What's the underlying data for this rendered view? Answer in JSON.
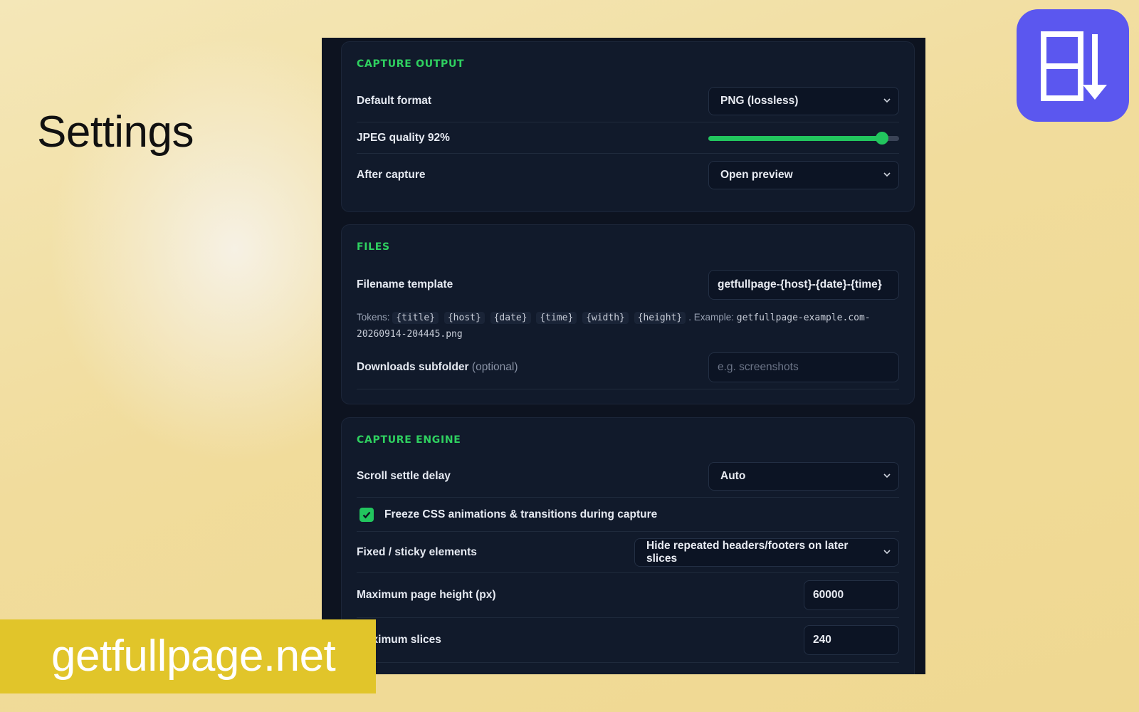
{
  "promo": {
    "title": "Settings",
    "banner": "getfullpage.net",
    "logo_icon": "page-download-icon",
    "logo_color": "#5b57ef",
    "banner_color": "#e1c52a"
  },
  "theme": {
    "accent": "#22c55e",
    "section_title_color": "#2fd160",
    "panel_bg": "#0d1320"
  },
  "capture_output": {
    "title": "CAPTURE OUTPUT",
    "default_format_label": "Default format",
    "default_format_value": "PNG (lossless)",
    "jpeg_quality_label": "JPEG quality 92%",
    "jpeg_quality_value": 92,
    "after_capture_label": "After capture",
    "after_capture_value": "Open preview"
  },
  "files": {
    "title": "FILES",
    "filename_template_label": "Filename template",
    "filename_template_value": "getfullpage-{host}-{date}-{time}",
    "tokens_prefix": "Tokens:",
    "tokens": [
      "{title}",
      "{host}",
      "{date}",
      "{time}",
      "{width}",
      "{height}"
    ],
    "example_prefix": ". Example:",
    "example_value": "getfullpage-example.com-20260914-204445.png",
    "subfolder_label": "Downloads subfolder",
    "subfolder_optional": "(optional)",
    "subfolder_placeholder": "e.g. screenshots"
  },
  "capture_engine": {
    "title": "CAPTURE ENGINE",
    "scroll_settle_label": "Scroll settle delay",
    "scroll_settle_value": "Auto",
    "freeze_label": "Freeze CSS animations & transitions during capture",
    "freeze_checked": true,
    "fixed_sticky_label": "Fixed / sticky elements",
    "fixed_sticky_value": "Hide repeated headers/footers on later slices",
    "max_height_label": "Maximum page height (px)",
    "max_height_value": "60000",
    "max_slices_label": "Maximum slices",
    "max_slices_value": "240"
  }
}
